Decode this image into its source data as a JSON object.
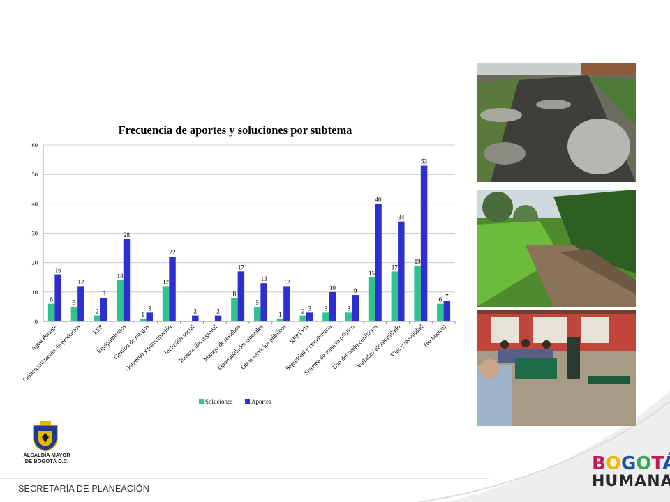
{
  "chart_data": {
    "type": "bar",
    "title": "Frecuencia de aportes y soluciones por subtema",
    "categories": [
      "Agua Potable",
      "Comercialización de productos",
      "EEP",
      "Equipamientos",
      "Gestión de riesgos",
      "Gobierno y participación",
      "Inclusión social",
      "Integración regional",
      "Manejo de residuos",
      "Oportunidades laborales",
      "Otros servicios públicos",
      "RFPTVH",
      "Seguridad y convivencia",
      "Sistema de espacio público",
      "Uso del suelo conflictos",
      "Valladas/ alcantarillado",
      "Vías y movilidad",
      "(en blanco)"
    ],
    "series": [
      {
        "name": "Soluciones",
        "color": "#2fc48f",
        "values": [
          6,
          5,
          2,
          14,
          1,
          12,
          null,
          null,
          8,
          5,
          1,
          2,
          3,
          3,
          15,
          17,
          19,
          6
        ]
      },
      {
        "name": "Aportes",
        "color": "#2f2fcf",
        "values": [
          16,
          12,
          8,
          28,
          3,
          22,
          2,
          2,
          17,
          13,
          12,
          3,
          10,
          9,
          40,
          34,
          53,
          7
        ]
      }
    ],
    "ylim": [
      0,
      60
    ],
    "yticks": [
      0,
      10,
      20,
      30,
      40,
      50,
      60
    ],
    "grid": true,
    "legend": "bottom"
  },
  "footer": {
    "department": "SECRETARÍA DE PLANEACIÓN",
    "crest_line1": "ALCALDÍA MAYOR",
    "crest_line2": "DE BOGOTÁ D.C.",
    "brand_line1": "BOGOTÁ",
    "brand_line2": "HUMANA"
  },
  "colors": {
    "soluciones": "#2fc48f",
    "aportes": "#2f2fcf",
    "brand_magenta": "#c2185b",
    "brand_yellow": "#f2b705",
    "brand_blue": "#1f4fa8",
    "brand_green": "#3aa657"
  },
  "photos": [
    "flooded-unpaved-road-photo",
    "stream-bank-photo",
    "community-meeting-photo"
  ]
}
